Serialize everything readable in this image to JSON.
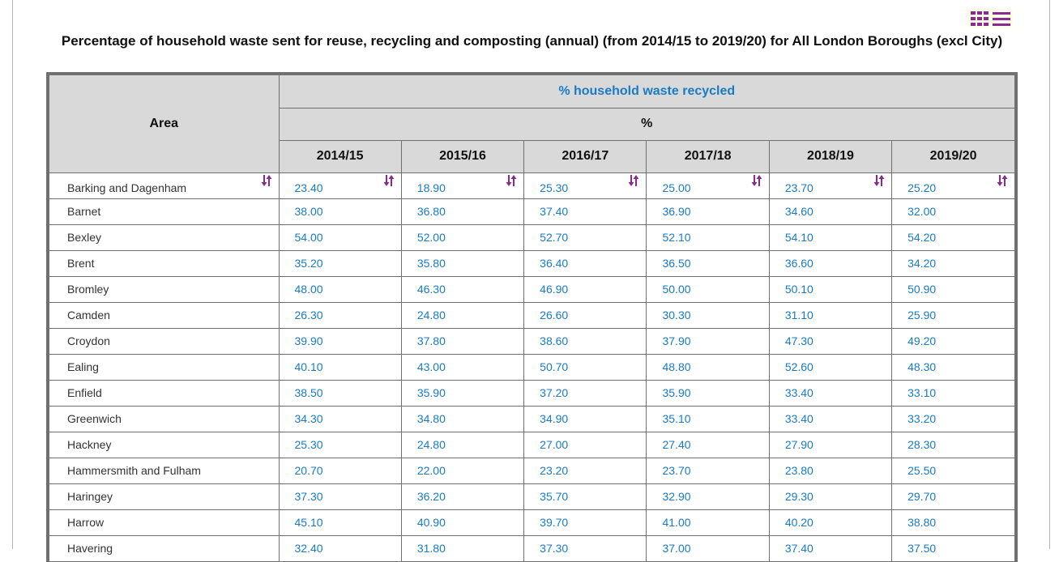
{
  "toolbar": {
    "view_toggle_icon": "grid-list-toggle-icon",
    "accent_color": "#8b2a8e"
  },
  "title": "Percentage of household waste sent for reuse, recycling and composting (annual) (from 2014/15 to 2019/20) for All London Boroughs (excl City)",
  "table": {
    "area_header": "Area",
    "measure_header": "% household waste recycled",
    "unit_header": "%",
    "sort_icon": "sort-arrows-icon",
    "columns": [
      "2014/15",
      "2015/16",
      "2016/17",
      "2017/18",
      "2018/19",
      "2019/20"
    ],
    "rows": [
      {
        "area": "Barking and Dagenham",
        "values": [
          "23.40",
          "18.90",
          "25.30",
          "25.00",
          "23.70",
          "25.20"
        ]
      },
      {
        "area": "Barnet",
        "values": [
          "38.00",
          "36.80",
          "37.40",
          "36.90",
          "34.60",
          "32.00"
        ]
      },
      {
        "area": "Bexley",
        "values": [
          "54.00",
          "52.00",
          "52.70",
          "52.10",
          "54.10",
          "54.20"
        ]
      },
      {
        "area": "Brent",
        "values": [
          "35.20",
          "35.80",
          "36.40",
          "36.50",
          "36.60",
          "34.20"
        ]
      },
      {
        "area": "Bromley",
        "values": [
          "48.00",
          "46.30",
          "46.90",
          "50.00",
          "50.10",
          "50.90"
        ]
      },
      {
        "area": "Camden",
        "values": [
          "26.30",
          "24.80",
          "26.60",
          "30.30",
          "31.10",
          "25.90"
        ]
      },
      {
        "area": "Croydon",
        "values": [
          "39.90",
          "37.80",
          "38.60",
          "37.90",
          "47.30",
          "49.20"
        ]
      },
      {
        "area": "Ealing",
        "values": [
          "40.10",
          "43.00",
          "50.70",
          "48.80",
          "52.60",
          "48.30"
        ]
      },
      {
        "area": "Enfield",
        "values": [
          "38.50",
          "35.90",
          "37.20",
          "35.90",
          "33.40",
          "33.10"
        ]
      },
      {
        "area": "Greenwich",
        "values": [
          "34.30",
          "34.80",
          "34.90",
          "35.10",
          "33.40",
          "33.20"
        ]
      },
      {
        "area": "Hackney",
        "values": [
          "25.30",
          "24.80",
          "27.00",
          "27.40",
          "27.90",
          "28.30"
        ]
      },
      {
        "area": "Hammersmith and Fulham",
        "values": [
          "20.70",
          "22.00",
          "23.20",
          "23.70",
          "23.80",
          "25.50"
        ]
      },
      {
        "area": "Haringey",
        "values": [
          "37.30",
          "36.20",
          "35.70",
          "32.90",
          "29.30",
          "29.70"
        ]
      },
      {
        "area": "Harrow",
        "values": [
          "45.10",
          "40.90",
          "39.70",
          "41.00",
          "40.20",
          "38.80"
        ]
      },
      {
        "area": "Havering",
        "values": [
          "32.40",
          "31.80",
          "37.30",
          "37.00",
          "37.40",
          "37.50"
        ]
      }
    ]
  }
}
